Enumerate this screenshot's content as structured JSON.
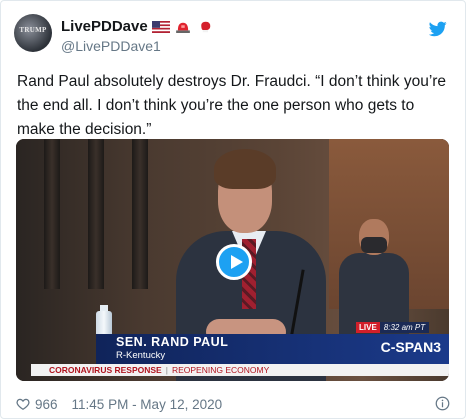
{
  "tweet": {
    "display_name": "LivePDDave",
    "handle": "@LivePDDave1",
    "avatar_text": "TRUMP",
    "text": "Rand Paul absolutely destroys Dr. Fraudci. “I don’t think you’re the end all. I don’t think you’re the one person who gets to make the decision.”",
    "likes": "966",
    "timestamp": "11:45 PM - May 12, 2020"
  },
  "video": {
    "live_label": "LIVE",
    "live_time": "8:32 am PT",
    "lower_third_name": "SEN. RAND PAUL",
    "lower_third_state": "R-Kentucky",
    "network": "C-SPAN3",
    "ticker_primary": "CORONAVIRUS RESPONSE",
    "ticker_separator": "|",
    "ticker_secondary": "REOPENING ECONOMY"
  },
  "colors": {
    "twitter_blue": "#1da1f2",
    "text_primary": "#14171a",
    "text_secondary": "#657786",
    "live_red": "#d21f2a",
    "lower_third_blue": "#1b3a8a"
  },
  "icons": [
    "us-flag-icon",
    "siren-icon",
    "boxing-glove-icon",
    "twitter-logo-icon",
    "play-icon",
    "heart-icon",
    "info-icon"
  ]
}
